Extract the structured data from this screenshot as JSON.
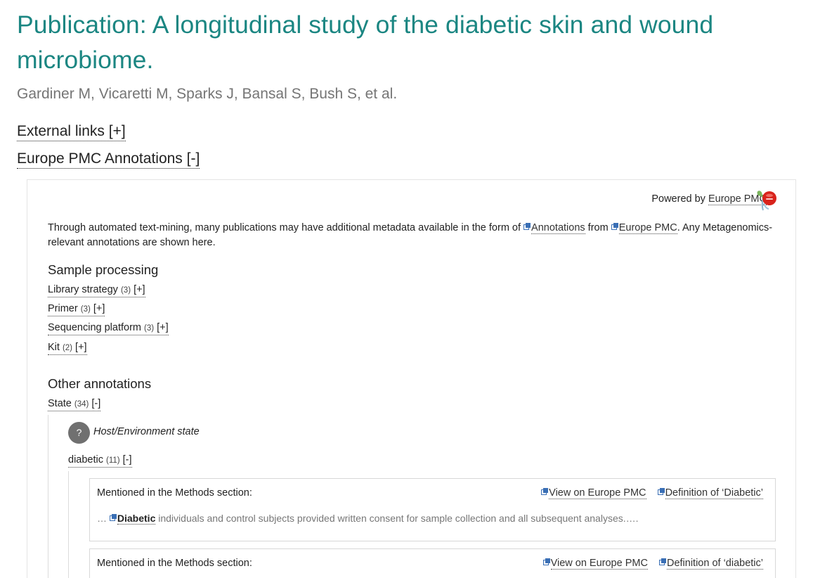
{
  "publication": {
    "title": "Publication: A longitudinal study of the diabetic skin and wound microbiome.",
    "authors": "Gardiner M, Vicaretti M, Sparks J, Bansal S, Bush S, et al."
  },
  "toggles": {
    "external_links": "External links [+]",
    "europe_pmc_annotations": "Europe PMC Annotations [-]"
  },
  "panel": {
    "powered_prefix": "Powered by ",
    "powered_link": "Europe PMC",
    "powered_suffix": ".",
    "intro_part1": "Through automated text-mining, many publications may have additional metadata available in the form of ",
    "intro_link1": "Annotations",
    "intro_part2": " from ",
    "intro_link2": "Europe PMC",
    "intro_part3": ". Any Metagenomics-relevant annotations are shown here."
  },
  "sample_processing": {
    "title": "Sample processing",
    "items": [
      {
        "label": "Library strategy",
        "count": "(3)",
        "toggle": "[+]"
      },
      {
        "label": "Primer",
        "count": "(3)",
        "toggle": "[+]"
      },
      {
        "label": "Sequencing platform",
        "count": "(3)",
        "toggle": "[+]"
      },
      {
        "label": "Kit",
        "count": "(2)",
        "toggle": "[+]"
      }
    ]
  },
  "other_annotations": {
    "title": "Other annotations",
    "state": {
      "label": "State",
      "count": "(34)",
      "toggle": "[-]"
    },
    "state_icon": "?",
    "state_type": "Host/Environment state",
    "term": {
      "label": "diabetic",
      "count": "(11)",
      "toggle": "[-]"
    }
  },
  "mentions": [
    {
      "heading": "Mentioned in the Methods section:",
      "view_link": "View on Europe PMC",
      "definition_link": "Definition of ‘Diabetic’",
      "snippet_prefix": "… ",
      "snippet_hit": "Diabetic",
      "snippet_rest": " individuals and control subjects provided written consent for sample collection and all subsequent analyses.…."
    },
    {
      "heading": "Mentioned in the Methods section:",
      "view_link": "View on Europe PMC",
      "definition_link": "Definition of ‘diabetic’"
    }
  ],
  "colors": {
    "title": "#1b8682",
    "authors": "#757575",
    "external_icon": "#3a6fb5"
  }
}
